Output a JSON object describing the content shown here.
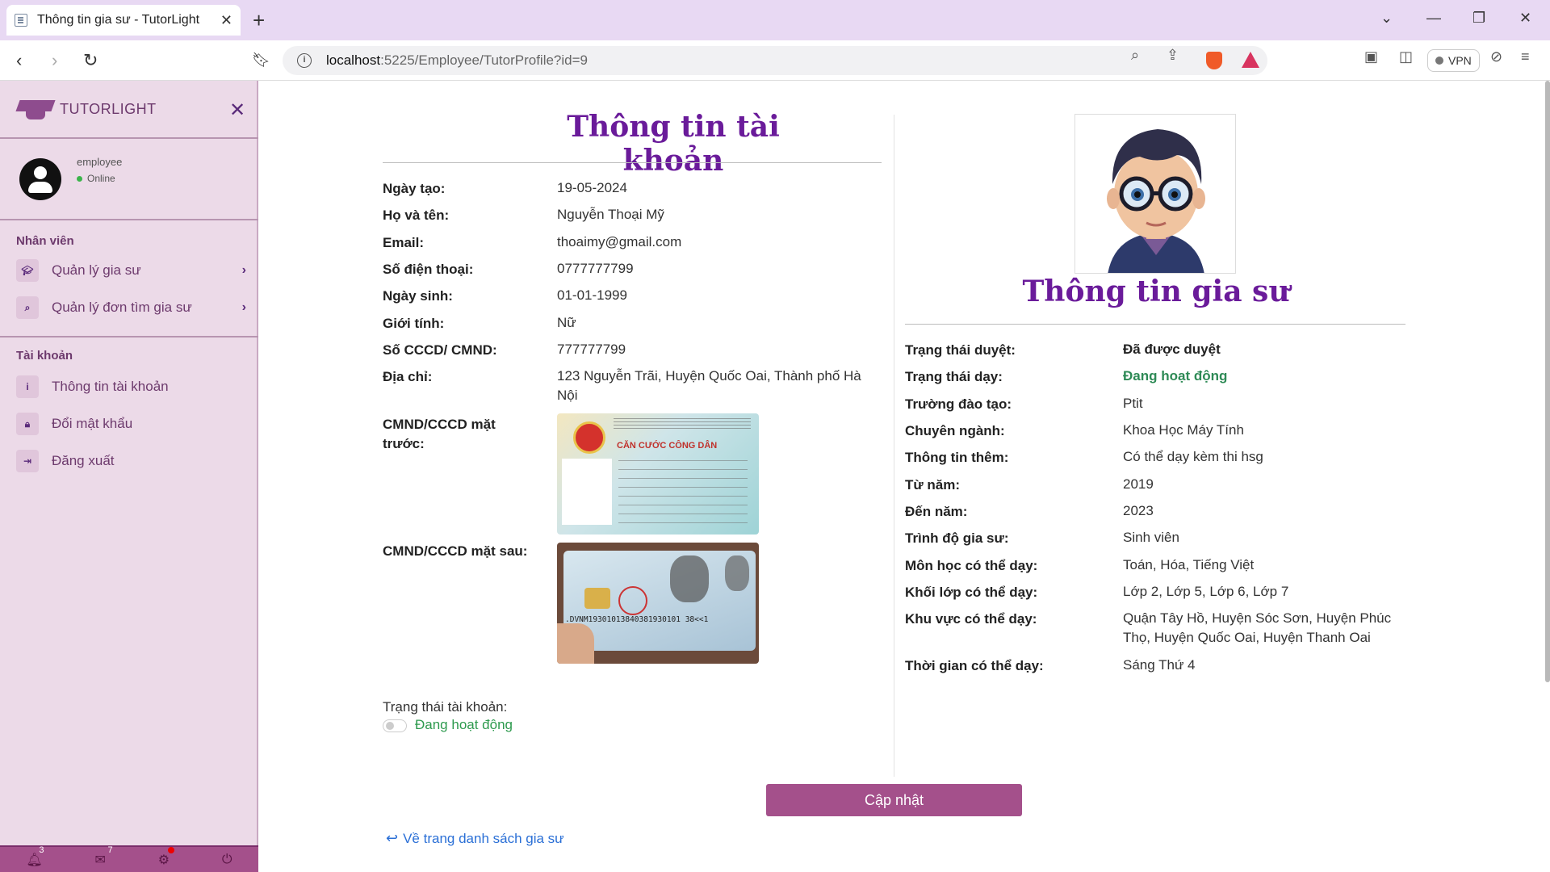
{
  "browser": {
    "tab_title": "Thông tin gia sư - TutorLight",
    "url_host": "localhost",
    "url_path": ":5225/Employee/TutorProfile?id=9",
    "vpn_label": "VPN"
  },
  "sidebar": {
    "brand": "TUTORLIGHT",
    "user_role": "employee",
    "user_status": "Online",
    "section_staff": "Nhân viên",
    "staff_items": [
      {
        "label": "Quản lý gia sư",
        "icon": "graduation-cap-icon"
      },
      {
        "label": "Quản lý đơn tìm gia sư",
        "icon": "search-icon"
      }
    ],
    "section_account": "Tài khoản",
    "account_items": [
      {
        "label": "Thông tin tài khoản",
        "icon": "info-icon"
      },
      {
        "label": "Đổi mật khẩu",
        "icon": "lock-icon"
      },
      {
        "label": "Đăng xuất",
        "icon": "logout-icon"
      }
    ],
    "notifications_count": "3",
    "messages_count": "7"
  },
  "account": {
    "title": "Thông tin tài khoản",
    "fields": [
      {
        "label": "Ngày tạo:",
        "value": "19-05-2024"
      },
      {
        "label": "Họ và tên:",
        "value": "Nguyễn Thoại Mỹ"
      },
      {
        "label": "Email:",
        "value": "thoaimy@gmail.com"
      },
      {
        "label": "Số điện thoại:",
        "value": "0777777799"
      },
      {
        "label": "Ngày sinh:",
        "value": "01-01-1999"
      },
      {
        "label": "Giới tính:",
        "value": "Nữ"
      },
      {
        "label": "Số CCCD/ CMND:",
        "value": "777777799"
      },
      {
        "label": "Địa chỉ:",
        "value": "123 Nguyễn Trãi, Huyện Quốc Oai, Thành phố Hà Nội"
      }
    ],
    "id_front_label": "CMND/CCCD mặt trước:",
    "id_back_label": "CMND/CCCD mặt sau:",
    "id_front_card_text": "CĂN CƯỚC CÔNG DÂN",
    "id_back_mrz": ".DVNM19301013840381930101 38<<1",
    "status_label": "Trạng thái tài khoản:",
    "status_value": "Đang hoạt động",
    "status_active": false,
    "update_button": "Cập nhật",
    "back_link": "Về trang danh sách gia sư"
  },
  "tutor": {
    "title": "Thông tin gia sư",
    "fields": [
      {
        "label": "Trạng thái duyệt:",
        "value": "Đã được duyệt"
      },
      {
        "label": "Trạng thái dạy:",
        "value": "Đang hoạt động"
      },
      {
        "label": "Trường đào tạo:",
        "value": "Ptit"
      },
      {
        "label": "Chuyên ngành:",
        "value": "Khoa Học Máy Tính"
      },
      {
        "label": "Thông tin thêm:",
        "value": "Có thể dạy kèm thi hsg"
      },
      {
        "label": "Từ năm:",
        "value": "2019"
      },
      {
        "label": "Đến năm:",
        "value": "2023"
      },
      {
        "label": "Trình độ gia sư:",
        "value": "Sinh viên"
      },
      {
        "label": "Môn học có thể dạy:",
        "value": "Toán, Hóa, Tiếng Việt"
      },
      {
        "label": "Khối lớp có thể dạy:",
        "value": "Lớp 2, Lớp 5, Lớp 6, Lớp 7"
      },
      {
        "label": "Khu vực có thể dạy:",
        "value": "Quận Tây Hồ, Huyện Sóc Sơn, Huyện Phúc Thọ, Huyện Quốc Oai, Huyện Thanh Oai"
      },
      {
        "label": "Thời gian có thể dạy:",
        "value": "Sáng Thứ 4"
      }
    ]
  },
  "colors": {
    "brand_purple": "#a4508b",
    "title_purple": "#6a1b9a",
    "sidebar_bg": "#ecdae8",
    "active_green": "#2e8a56"
  }
}
